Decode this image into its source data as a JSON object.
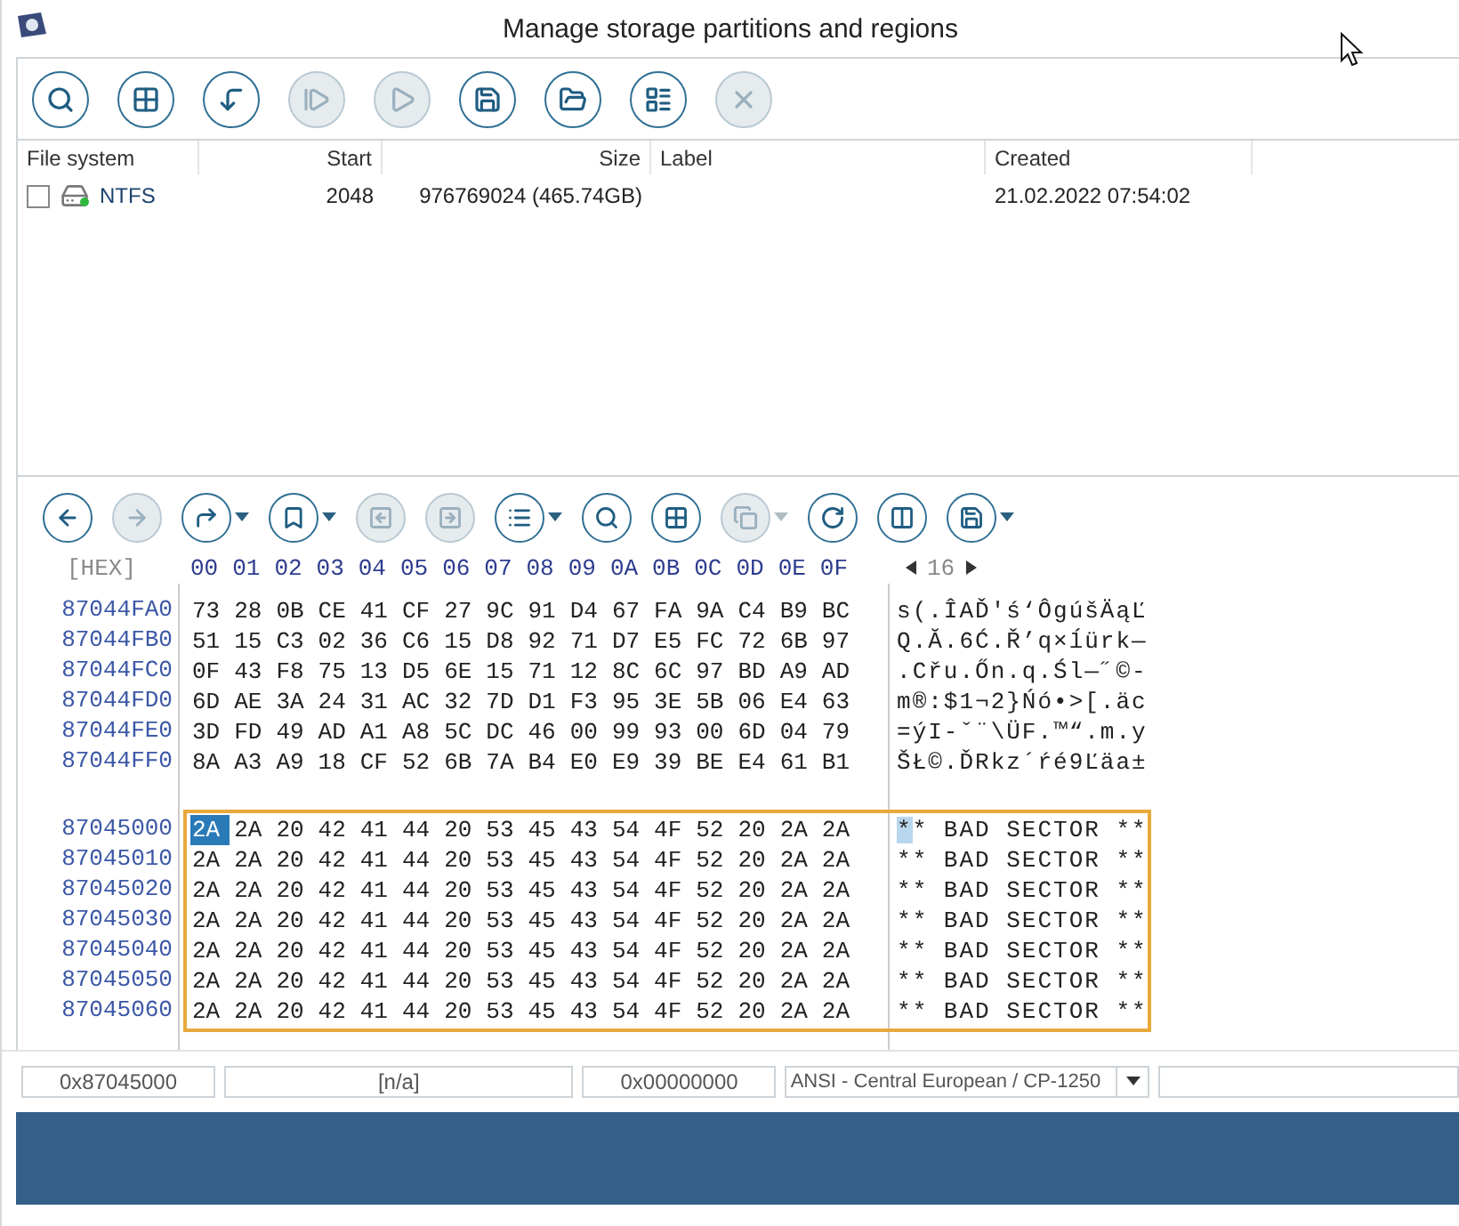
{
  "window": {
    "title": "Manage storage partitions and regions"
  },
  "toolbar": [
    {
      "disabled": false
    },
    {
      "disabled": false
    },
    {
      "disabled": false
    },
    {
      "disabled": true
    },
    {
      "disabled": true
    },
    {
      "disabled": false
    },
    {
      "disabled": false
    },
    {
      "disabled": false
    },
    {
      "disabled": true
    }
  ],
  "table": {
    "columns": [
      "File system",
      "Start",
      "Size",
      "Label",
      "Created"
    ],
    "rows": [
      {
        "checked": false,
        "file_system": "NTFS",
        "start": "2048",
        "size": "976769024 (465.74GB)",
        "created": "21.02.2022 07:54:02"
      }
    ]
  },
  "hex_toolbar": [
    {
      "disabled": false,
      "menu": false
    },
    {
      "disabled": true,
      "menu": false
    },
    {
      "disabled": false,
      "menu": true
    },
    {
      "disabled": false,
      "menu": true
    },
    {
      "disabled": true,
      "menu": false
    },
    {
      "disabled": true,
      "menu": false
    },
    {
      "disabled": false,
      "menu": true
    },
    {
      "disabled": false,
      "menu": false
    },
    {
      "disabled": false,
      "menu": false
    },
    {
      "disabled": true,
      "menu": true
    },
    {
      "disabled": false,
      "menu": false
    },
    {
      "disabled": false,
      "menu": false
    },
    {
      "disabled": false,
      "menu": true
    }
  ],
  "hex_header": {
    "mode": "[HEX]",
    "offsets": [
      "00",
      "01",
      "02",
      "03",
      "04",
      "05",
      "06",
      "07",
      "08",
      "09",
      "0A",
      "0B",
      "0C",
      "0D",
      "0E",
      "0F"
    ],
    "bytes_per_row": "16"
  },
  "blocks": [
    {
      "marked": false,
      "rows": [
        {
          "address": "87044FA0",
          "bytes": [
            "73",
            "28",
            "0B",
            "CE",
            "41",
            "CF",
            "27",
            "9C",
            "91",
            "D4",
            "67",
            "FA",
            "9A",
            "C4",
            "B9",
            "BC"
          ],
          "text": "s(.ÎAĎ'ś‘ÔgúšÄąĽ",
          "cursor": false
        },
        {
          "address": "87044FB0",
          "bytes": [
            "51",
            "15",
            "C3",
            "02",
            "36",
            "C6",
            "15",
            "D8",
            "92",
            "71",
            "D7",
            "E5",
            "FC",
            "72",
            "6B",
            "97"
          ],
          "text": "Q.Ă.6Ć.Ř’q×ĺürk—",
          "cursor": false
        },
        {
          "address": "87044FC0",
          "bytes": [
            "0F",
            "43",
            "F8",
            "75",
            "13",
            "D5",
            "6E",
            "15",
            "71",
            "12",
            "8C",
            "6C",
            "97",
            "BD",
            "A9",
            "AD"
          ],
          "text": ".Cřu.Őn.q.Śl—˝©-",
          "cursor": false
        },
        {
          "address": "87044FD0",
          "bytes": [
            "6D",
            "AE",
            "3A",
            "24",
            "31",
            "AC",
            "32",
            "7D",
            "D1",
            "F3",
            "95",
            "3E",
            "5B",
            "06",
            "E4",
            "63"
          ],
          "text": "m®:$1¬2}Ńó•>[.äc",
          "cursor": false
        },
        {
          "address": "87044FE0",
          "bytes": [
            "3D",
            "FD",
            "49",
            "AD",
            "A1",
            "A8",
            "5C",
            "DC",
            "46",
            "00",
            "99",
            "93",
            "00",
            "6D",
            "04",
            "79"
          ],
          "text": "=ýI-ˇ¨\\ÜF.™“.m.y",
          "cursor": false
        },
        {
          "address": "87044FF0",
          "bytes": [
            "8A",
            "A3",
            "A9",
            "18",
            "CF",
            "52",
            "6B",
            "7A",
            "B4",
            "E0",
            "E9",
            "39",
            "BE",
            "E4",
            "61",
            "B1"
          ],
          "text": "ŠŁ©.ĎRkz´ŕé9Ľäa±",
          "cursor": false
        }
      ]
    },
    {
      "marked": true,
      "rows": [
        {
          "address": "87045000",
          "bytes": [
            "2A",
            "2A",
            "20",
            "42",
            "41",
            "44",
            "20",
            "53",
            "45",
            "43",
            "54",
            "4F",
            "52",
            "20",
            "2A",
            "2A"
          ],
          "text": "** BAD SECTOR **",
          "cursor": true
        },
        {
          "address": "87045010",
          "bytes": [
            "2A",
            "2A",
            "20",
            "42",
            "41",
            "44",
            "20",
            "53",
            "45",
            "43",
            "54",
            "4F",
            "52",
            "20",
            "2A",
            "2A"
          ],
          "text": "** BAD SECTOR **",
          "cursor": false
        },
        {
          "address": "87045020",
          "bytes": [
            "2A",
            "2A",
            "20",
            "42",
            "41",
            "44",
            "20",
            "53",
            "45",
            "43",
            "54",
            "4F",
            "52",
            "20",
            "2A",
            "2A"
          ],
          "text": "** BAD SECTOR **",
          "cursor": false
        },
        {
          "address": "87045030",
          "bytes": [
            "2A",
            "2A",
            "20",
            "42",
            "41",
            "44",
            "20",
            "53",
            "45",
            "43",
            "54",
            "4F",
            "52",
            "20",
            "2A",
            "2A"
          ],
          "text": "** BAD SECTOR **",
          "cursor": false
        },
        {
          "address": "87045040",
          "bytes": [
            "2A",
            "2A",
            "20",
            "42",
            "41",
            "44",
            "20",
            "53",
            "45",
            "43",
            "54",
            "4F",
            "52",
            "20",
            "2A",
            "2A"
          ],
          "text": "** BAD SECTOR **",
          "cursor": false
        },
        {
          "address": "87045050",
          "bytes": [
            "2A",
            "2A",
            "20",
            "42",
            "41",
            "44",
            "20",
            "53",
            "45",
            "43",
            "54",
            "4F",
            "52",
            "20",
            "2A",
            "2A"
          ],
          "text": "** BAD SECTOR **",
          "cursor": false
        },
        {
          "address": "87045060",
          "bytes": [
            "2A",
            "2A",
            "20",
            "42",
            "41",
            "44",
            "20",
            "53",
            "45",
            "43",
            "54",
            "4F",
            "52",
            "20",
            "2A",
            "2A"
          ],
          "text": "** BAD SECTOR **",
          "cursor": false
        }
      ]
    }
  ],
  "status_bar": {
    "offset": "0x87045000",
    "value": "[n/a]",
    "selection": "0x00000000",
    "encoding": "ANSI - Central European / CP-1250"
  }
}
